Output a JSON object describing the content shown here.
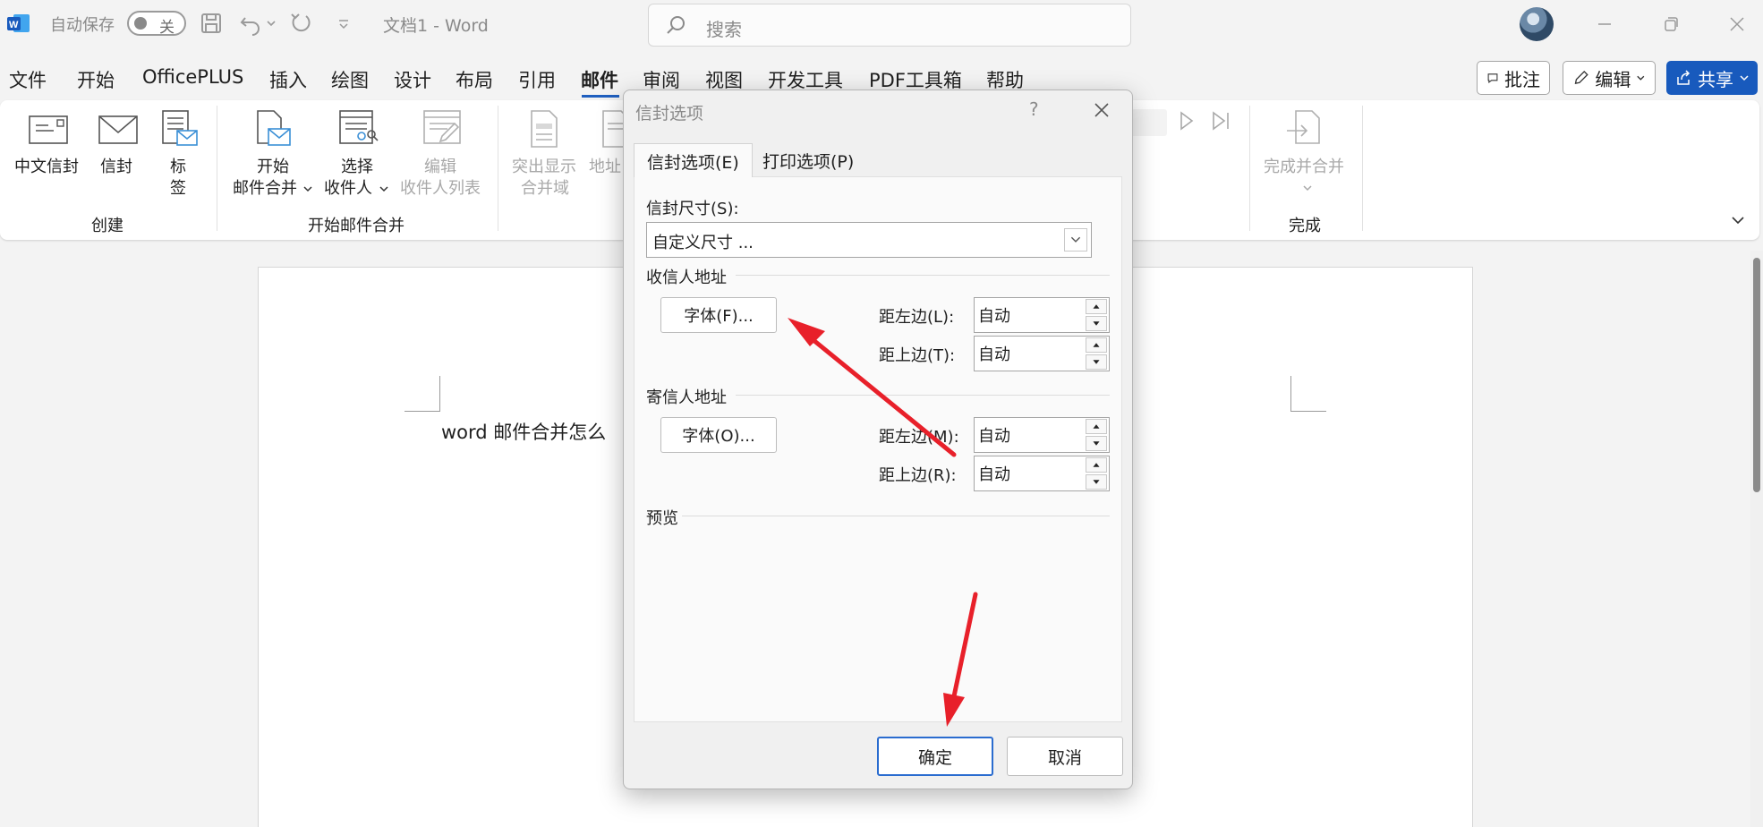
{
  "titlebar": {
    "autosave_label": "自动保存",
    "autosave_state": "关",
    "doc_title": "文档1  -  Word",
    "search_placeholder": "搜索"
  },
  "menu": {
    "items": [
      "文件",
      "开始",
      "OfficePLUS",
      "插入",
      "绘图",
      "设计",
      "布局",
      "引用",
      "邮件",
      "审阅",
      "视图",
      "开发工具",
      "PDF工具箱",
      "帮助"
    ],
    "active": "邮件",
    "comment_label": "批注",
    "edit_label": "编辑",
    "share_label": "共享"
  },
  "ribbon": {
    "create_group": "创建",
    "chinese_envelope": "中文信封",
    "envelope": "信封",
    "label_line1": "标",
    "label_line2": "签",
    "start_merge_group": "开始邮件合并",
    "start_line1": "开始",
    "start_line2": "邮件合并",
    "select_line1": "选择",
    "select_line2": "收件人",
    "edit_line1": "编辑",
    "edit_line2": "收件人列表",
    "highlight_line1": "突出显示",
    "highlight_line2": "合并域",
    "address_partial": "地址",
    "finish_group": "完成",
    "finish_merge": "完成并合并"
  },
  "document": {
    "text": "word 邮件合并怎么"
  },
  "dialog": {
    "title": "信封选项",
    "help": "?",
    "tab_envelope": "信封选项(E)",
    "tab_print": "打印选项(P)",
    "size_label": "信封尺寸(S):",
    "size_value": "自定义尺寸 ...",
    "recipient_section": "收信人地址",
    "recipient_font_btn": "字体(F)...",
    "recipient_left_label": "距左边(L):",
    "recipient_left_value": "自动",
    "recipient_top_label": "距上边(T):",
    "recipient_top_value": "自动",
    "sender_section": "寄信人地址",
    "sender_font_btn": "字体(O)...",
    "sender_left_label": "距左边(M):",
    "sender_left_value": "自动",
    "sender_top_label": "距上边(R):",
    "sender_top_value": "自动",
    "preview_section": "预览",
    "ok_label": "确定",
    "cancel_label": "取消"
  },
  "colors": {
    "accent": "#185abd",
    "annotation_arrow": "#e8202a"
  }
}
